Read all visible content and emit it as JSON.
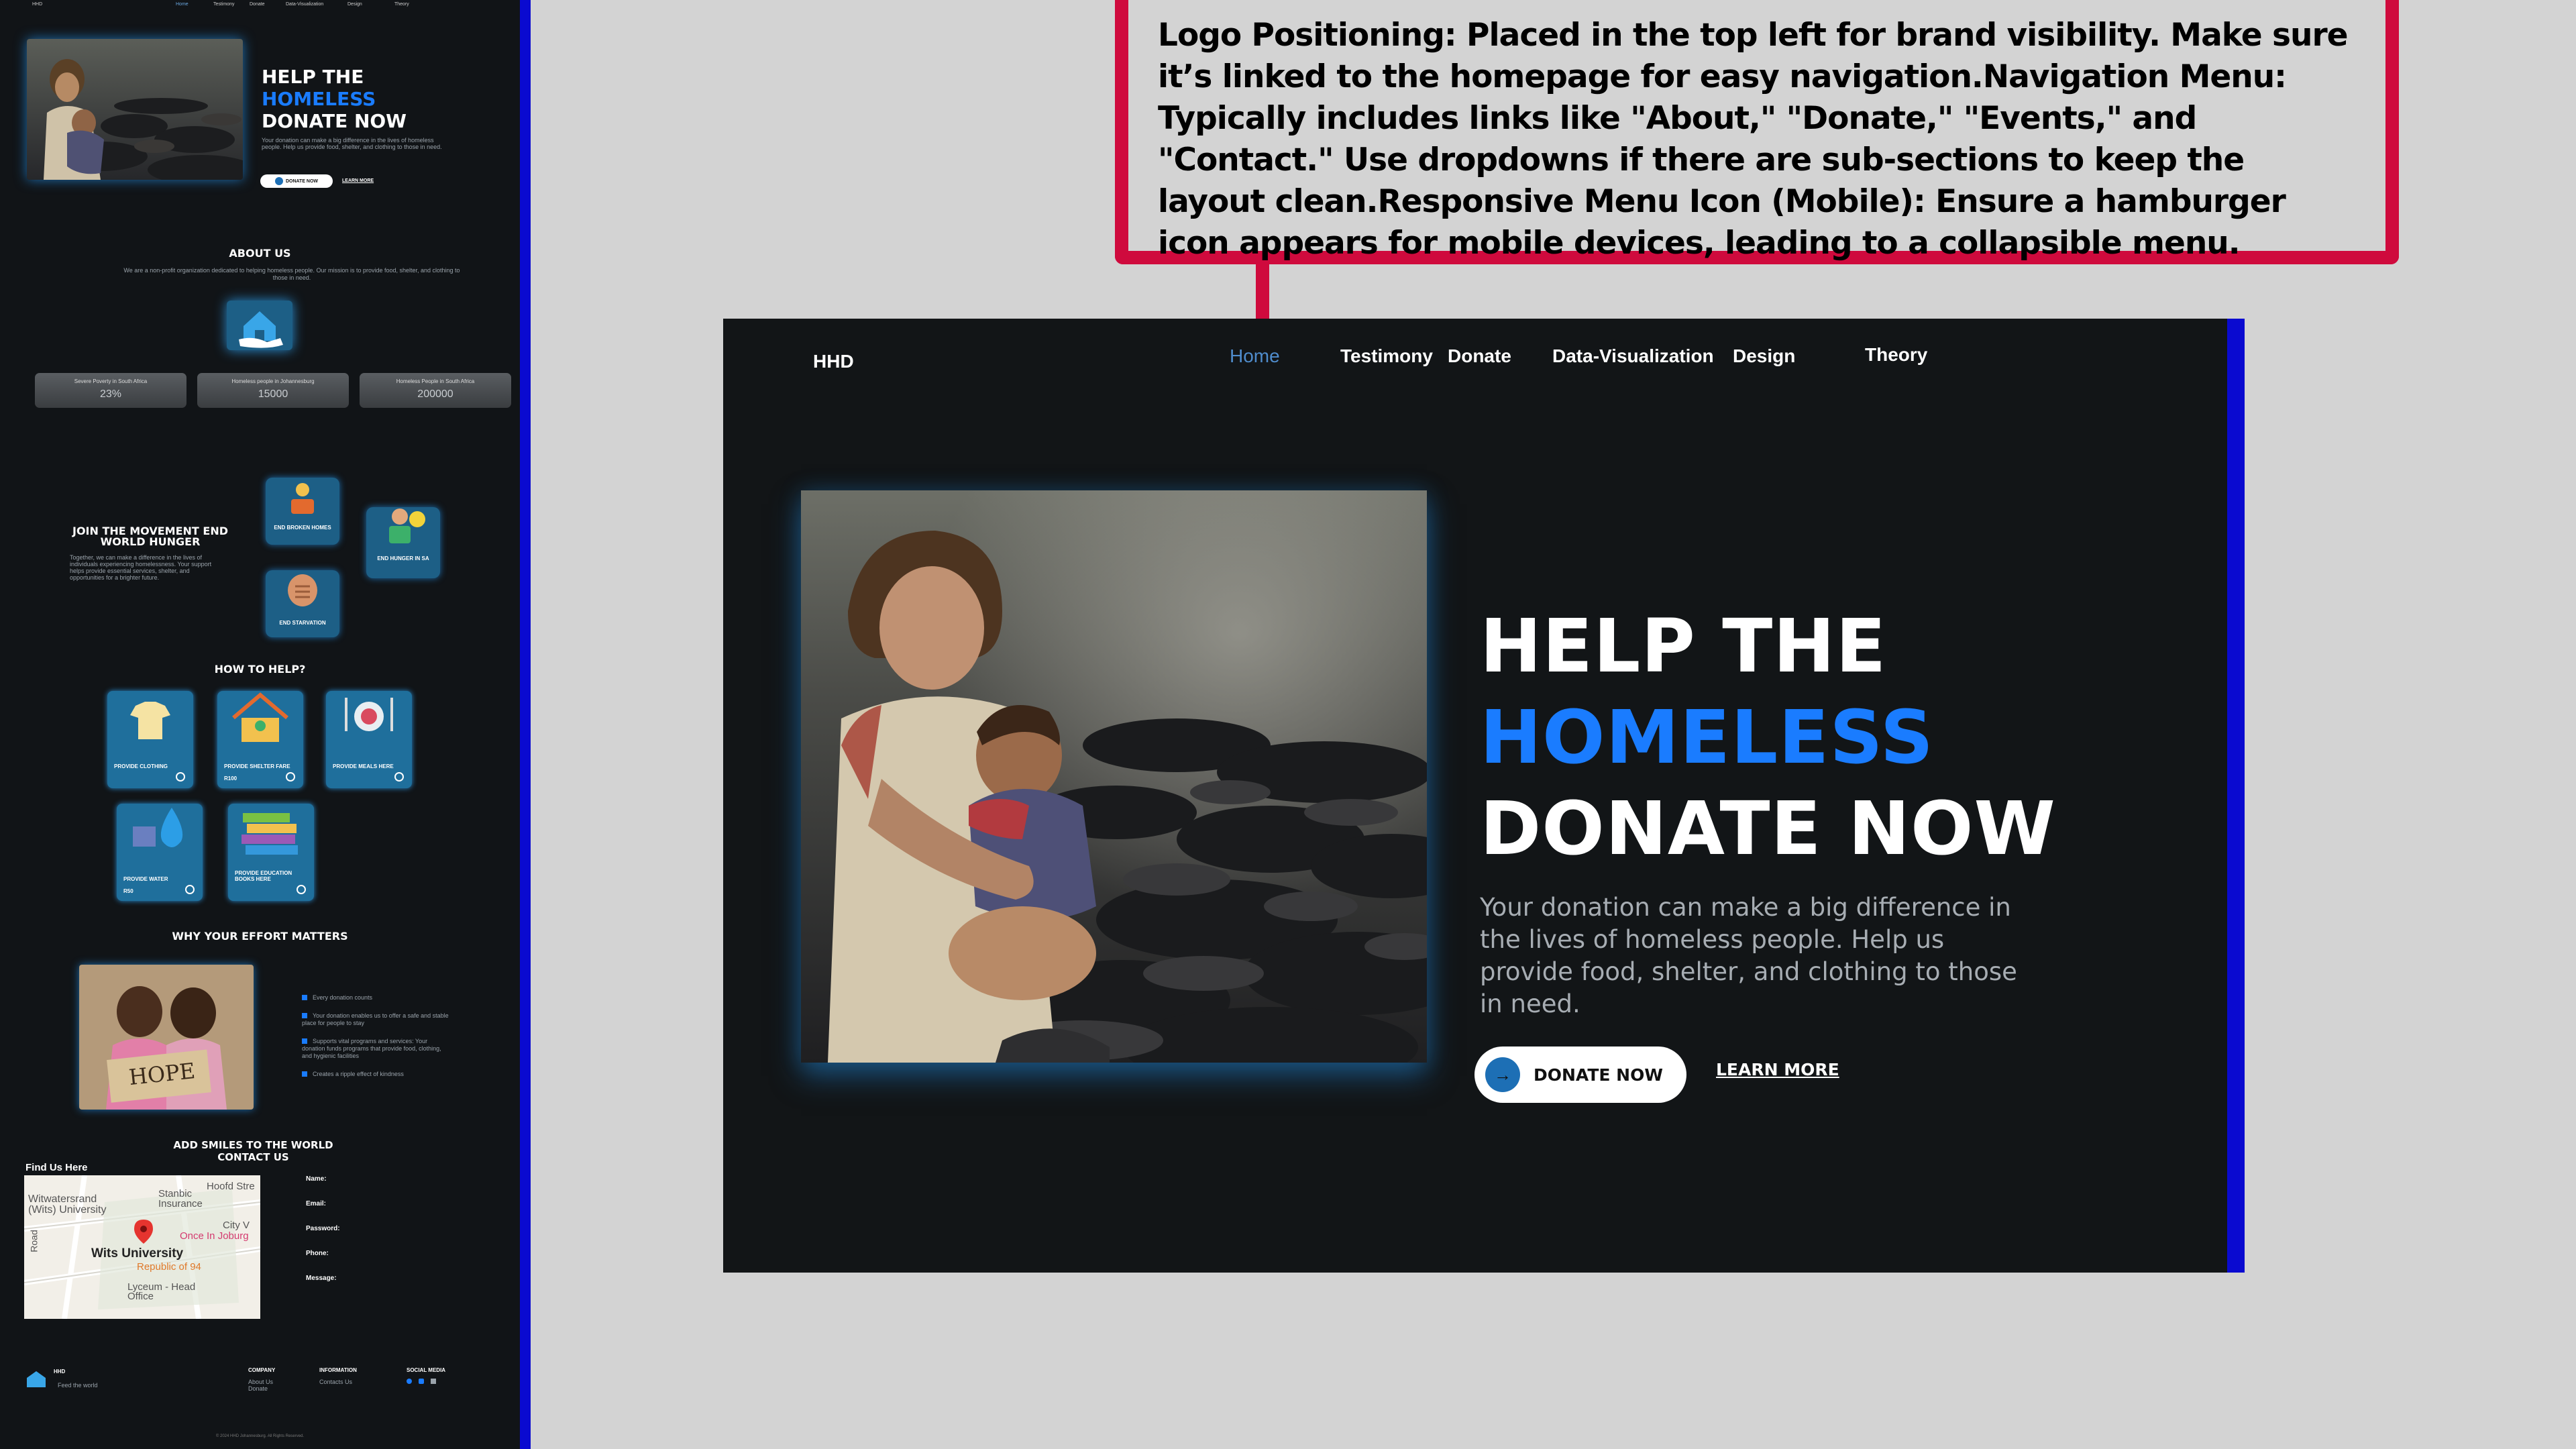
{
  "callout": {
    "text": "Logo Positioning: Placed in the top left for brand visibility. Make sure it’s linked to the homepage for easy navigation.Navigation Menu: Typically includes links like \"About,\" \"Donate,\" \"Events,\" and \"Contact.\" Use dropdowns if there are sub-sections to keep the layout clean.Responsive Menu Icon (Mobile): Ensure a hamburger icon appears for mobile devices, leading to a collapsible menu."
  },
  "nav": {
    "logo": "HHD",
    "items": [
      "Home",
      "Testimony",
      "Donate",
      "Data-Visualization",
      "Design",
      "Theory"
    ],
    "active": "Home"
  },
  "hero": {
    "line1": "HELP THE",
    "line2": "HOMELESS",
    "line3": "DONATE NOW",
    "description": "Your donation can make a big difference in the lives of homeless people. Help us provide food, shelter, and clothing to those in need.",
    "donate_label": "DONATE NOW",
    "learn_more_label": "LEARN MORE"
  },
  "preview": {
    "about_title": "ABOUT US",
    "about_text": "We are a non-profit organization dedicated to helping homeless people. Our mission is to provide food, shelter, and clothing to those in need.",
    "stats": [
      {
        "label": "Severe Poverty in South Africa",
        "value": "23%"
      },
      {
        "label": "Homeless people in Johannesburg",
        "value": "15000"
      },
      {
        "label": "Homeless People in South Africa",
        "value": "200000"
      }
    ],
    "join_title": "JOIN THE MOVEMENT END WORLD HUNGER",
    "join_text": "Together, we can make a difference in the lives of individuals experiencing homelessness. Your support helps provide essential services, shelter, and opportunities for a brighter future.",
    "tiles": [
      "END BROKEN HOMES",
      "END HUNGER IN SA",
      "END STARVATION"
    ],
    "help_title": "HOW TO HELP?",
    "help_cards": [
      {
        "title": "PROVIDE CLOTHING",
        "price": ""
      },
      {
        "title": "PROVIDE SHELTER FARE",
        "price": "R100"
      },
      {
        "title": "PROVIDE MEALS HERE",
        "price": ""
      },
      {
        "title": "PROVIDE WATER",
        "price": "R50"
      },
      {
        "title": "PROVIDE EDUCATION BOOKS HERE",
        "price": ""
      }
    ],
    "effort_title": "WHY YOUR EFFORT MATTERS",
    "hope_sign": "HOPE",
    "effort_bullets": [
      "Every donation counts",
      "Your donation enables us to offer a safe and stable place for people to stay",
      "Supports vital programs and services: Your donation funds programs that provide food, clothing, and hygienic facilities",
      "Creates a ripple effect of kindness"
    ],
    "smiles_title": "ADD SMILES TO THE WORLD",
    "contact_title": "CONTACT US",
    "find_us": "Find Us Here",
    "map_labels": [
      "Witwatersrand (Wits) University",
      "Stanbic Insurance",
      "Hoofd Stre",
      "City V",
      "Once In Joburg",
      "Wits University",
      "Republic of 94",
      "Lyceum - Head Office",
      "Road"
    ],
    "form_fields": [
      "Name:",
      "Email:",
      "Password:",
      "Phone:",
      "Message:"
    ],
    "footer_logo": "HHD",
    "footer_tag": "Feed the world",
    "footer_cols": [
      {
        "title": "COMPANY",
        "items": [
          "About Us",
          "Donate"
        ]
      },
      {
        "title": "INFORMATION",
        "items": [
          "Contacts Us"
        ]
      },
      {
        "title": "SOCIAL MEDIA",
        "items": []
      }
    ],
    "copyright": "© 2024 HHD Johannesburg. All Rights Reserved."
  },
  "colors": {
    "accent_blue": "#1a7cff",
    "callout_red": "#cf0a3d",
    "edge_blue": "#0a0ad0",
    "bg_dark": "#121517"
  }
}
